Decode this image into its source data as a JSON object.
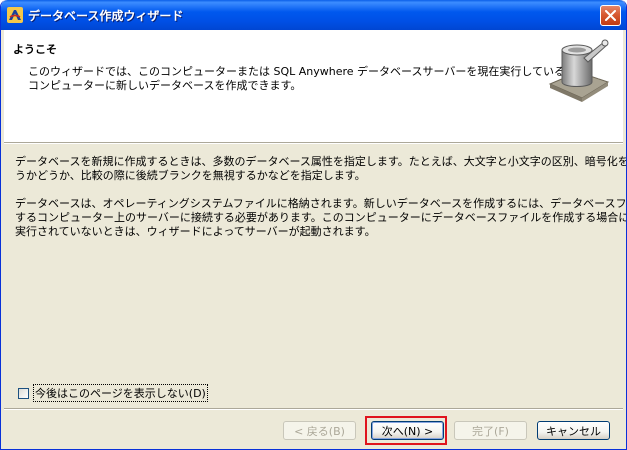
{
  "window": {
    "title": "データベース作成ウィザード"
  },
  "header": {
    "title": "ようこそ",
    "description_lines": [
      "このウィザードでは、このコンピューターまたは SQL Anywhere データベースサーバーを現在実行している別の",
      "コンピューターに新しいデータベースを作成できます。"
    ]
  },
  "body": {
    "paragraph1_lines": [
      "データベースを新規に作成するときは、多数のデータベース属性を指定します。たとえば、大文字と小文字の区別、暗号化を行",
      "うかどうか、比較の際に後続ブランクを無視するかなどを指定します。"
    ],
    "paragraph2_lines": [
      "データベースは、オペレーティングシステムファイルに格納されます。新しいデータベースを作成するには、データベースファイルを格納",
      "するコンピューター上のサーバーに接続する必要があります。このコンピューターにデータベースファイルを作成する場合にサーバーが",
      "実行されていないときは、ウィザードによってサーバーが起動されます。"
    ]
  },
  "options": {
    "dont_show_again_label": "今後はこのページを表示しない(D)",
    "dont_show_again_checked": false
  },
  "buttons": {
    "back": "< 戻る(B)",
    "next": "次へ(N) >",
    "finish": "完了(F)",
    "cancel": "キャンセル"
  },
  "colors": {
    "titlebar": "#0058ee",
    "dialog_bg": "#ece9d8",
    "highlight": "#e0141e"
  }
}
